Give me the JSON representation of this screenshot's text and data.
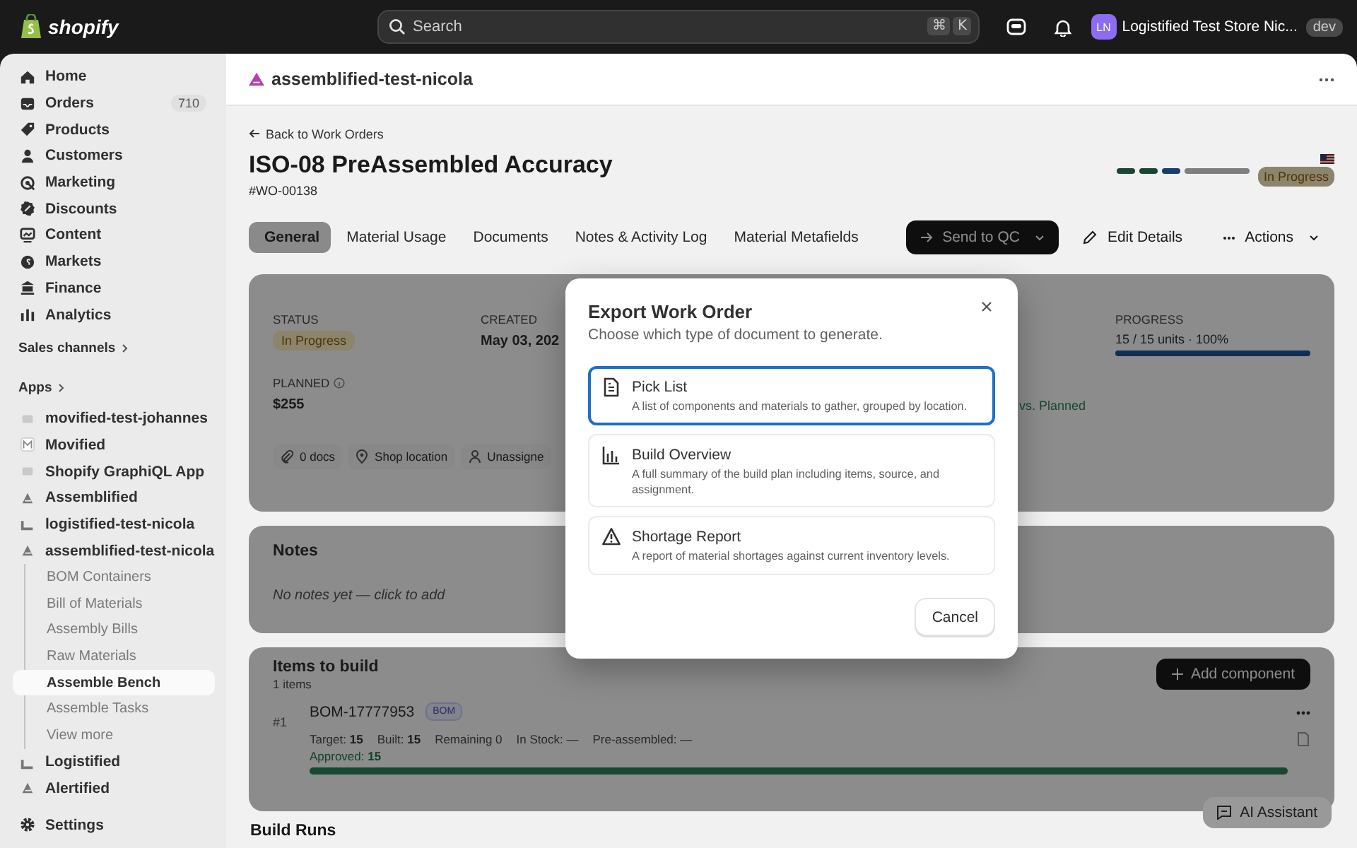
{
  "topbar": {
    "brand": "shopify",
    "search": {
      "placeholder": "Search"
    },
    "shortcut_keys": [
      "⌘",
      "K"
    ],
    "store": {
      "initials": "LN",
      "name": "Logistified Test Store Nic...",
      "badge": "dev"
    }
  },
  "sidebar": {
    "items": [
      {
        "label": "Home"
      },
      {
        "label": "Orders",
        "count": "710"
      },
      {
        "label": "Products"
      },
      {
        "label": "Customers"
      },
      {
        "label": "Marketing"
      },
      {
        "label": "Discounts"
      },
      {
        "label": "Content"
      },
      {
        "label": "Markets"
      },
      {
        "label": "Finance"
      },
      {
        "label": "Analytics"
      }
    ],
    "sales_channels": "Sales channels",
    "apps_heading": "Apps",
    "apps": [
      {
        "label": "movified-test-johannes"
      },
      {
        "label": "Movified"
      },
      {
        "label": "Shopify GraphiQL App"
      },
      {
        "label": "Assemblified"
      },
      {
        "label": "logistified-test-nicola"
      },
      {
        "label": "assemblified-test-nicola",
        "children": [
          {
            "label": "BOM Containers",
            "selected": false
          },
          {
            "label": "Bill of Materials",
            "selected": false
          },
          {
            "label": "Assembly Bills",
            "selected": false
          },
          {
            "label": "Raw Materials",
            "selected": false
          },
          {
            "label": "Assemble Bench",
            "selected": true
          },
          {
            "label": "Assemble Tasks",
            "selected": false
          },
          {
            "label": "View more",
            "selected": false
          }
        ]
      },
      {
        "label": "Logistified"
      },
      {
        "label": "Alertified"
      }
    ],
    "settings": "Settings"
  },
  "app_header": {
    "title": "assemblified-test-nicola"
  },
  "page": {
    "back_link": "Back to Work Orders",
    "title": "ISO-08 PreAssembled Accuracy",
    "id": "#WO-00138",
    "status": "In Progress",
    "tabs": [
      {
        "label": "General",
        "selected": true
      },
      {
        "label": "Material Usage",
        "selected": false
      },
      {
        "label": "Documents",
        "selected": false
      },
      {
        "label": "Notes & Activity Log",
        "selected": false
      },
      {
        "label": "Material Metafields",
        "selected": false
      }
    ],
    "actions": [
      {
        "label": "Send to QC",
        "kind": "primary"
      },
      {
        "label": "Edit Details",
        "kind": "edit"
      },
      {
        "label": "Actions",
        "kind": "menu"
      }
    ],
    "summary": {
      "fields": [
        {
          "label": "STATUS",
          "value": "In Progress",
          "kind": "badge"
        },
        {
          "label": "CREATED",
          "value": "May 03, 202",
          "kind": "text"
        },
        {
          "label": "PROGRESS",
          "value": "15 / 15 units · 100%",
          "kind": "progress",
          "level": 1
        },
        {
          "label": "PLANNED",
          "value": "$255",
          "kind": "text"
        }
      ],
      "variance": "vs. Planned",
      "chips": [
        "0 docs",
        "Shop location",
        "Unassigne"
      ]
    },
    "notes": {
      "title": "Notes",
      "placeholder": "No notes yet — click to add"
    },
    "items": {
      "title": "Items to build",
      "count": "1 items",
      "add_button": "Add component",
      "rows": [
        {
          "index": "#1",
          "name": "BOM-17777953",
          "badge": "BOM",
          "stats": [
            "Target: **15**",
            "Built: **15**",
            "Remaining 0",
            "In Stock: —",
            "Pre-assembled: —"
          ],
          "approved": "Approved: **15**",
          "level": 1
        }
      ]
    },
    "build_runs": {
      "title": "Build Runs"
    },
    "assistant_button": "AI Assistant"
  },
  "modal": {
    "title": "Export Work Order",
    "subtitle": "Choose which type of document to generate.",
    "options": [
      {
        "title": "Pick List",
        "description": "A list of components and materials to gather, grouped by location.",
        "selected": true
      },
      {
        "title": "Build Overview",
        "description": "A full summary of the build plan including items, source, and assignment.",
        "selected": false
      },
      {
        "title": "Shortage Report",
        "description": "A report of material shortages against current inventory levels.",
        "selected": false
      }
    ],
    "cancel": "Cancel"
  }
}
